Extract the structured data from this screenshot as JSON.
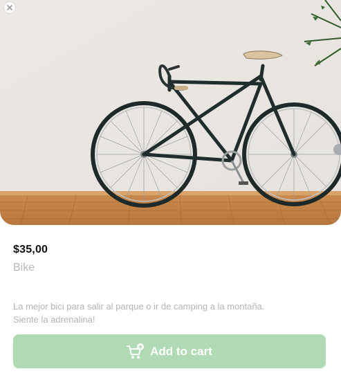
{
  "product": {
    "price": "$35,00",
    "name": "Bike",
    "description_line1": "La mejor bici para salir al parque o ir de camping a la montaña.",
    "description_line2": "Siente la adrenalina!",
    "image": "bike-photo"
  },
  "actions": {
    "add_to_cart_label": "Add to cart",
    "close_icon": "close-icon",
    "cart_icon": "cart-plus-icon"
  },
  "colors": {
    "button": "#b0dab4",
    "price": "#111111",
    "muted_text": "#b4b4b4"
  }
}
